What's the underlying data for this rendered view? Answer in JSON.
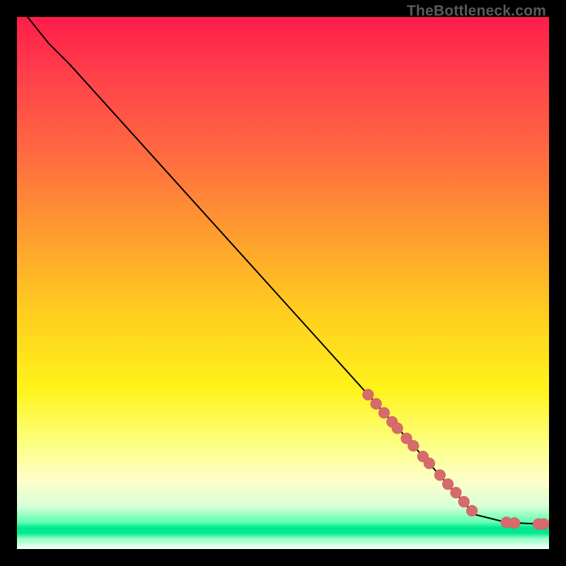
{
  "watermark": "TheBottleneck.com",
  "colors": {
    "dot": "#d76a6a",
    "line": "#000000"
  },
  "chart_data": {
    "type": "line",
    "title": "",
    "xlabel": "",
    "ylabel": "",
    "xlim": [
      0,
      100
    ],
    "ylim": [
      0,
      100
    ],
    "grid": false,
    "legend": false,
    "curve": [
      {
        "x": 2,
        "y": 100
      },
      {
        "x": 6,
        "y": 95
      },
      {
        "x": 10,
        "y": 91
      },
      {
        "x": 66,
        "y": 29
      },
      {
        "x": 86,
        "y": 6.5
      },
      {
        "x": 90,
        "y": 5.5
      },
      {
        "x": 92,
        "y": 5
      },
      {
        "x": 96,
        "y": 4.8
      },
      {
        "x": 99,
        "y": 4.7
      }
    ],
    "highlight_points": [
      {
        "x": 66,
        "y": 29
      },
      {
        "x": 67.5,
        "y": 27.3
      },
      {
        "x": 69,
        "y": 25.6
      },
      {
        "x": 70.5,
        "y": 23.9
      },
      {
        "x": 71.5,
        "y": 22.7
      },
      {
        "x": 73.2,
        "y": 20.8
      },
      {
        "x": 74.5,
        "y": 19.4
      },
      {
        "x": 76.3,
        "y": 17.4
      },
      {
        "x": 77.5,
        "y": 16.1
      },
      {
        "x": 79.5,
        "y": 13.9
      },
      {
        "x": 81,
        "y": 12.2
      },
      {
        "x": 82.5,
        "y": 10.6
      },
      {
        "x": 84,
        "y": 8.9
      },
      {
        "x": 85.5,
        "y": 7.2
      },
      {
        "x": 92,
        "y": 5
      },
      {
        "x": 93.5,
        "y": 4.9
      },
      {
        "x": 98,
        "y": 4.7
      },
      {
        "x": 99,
        "y": 4.7
      }
    ]
  }
}
